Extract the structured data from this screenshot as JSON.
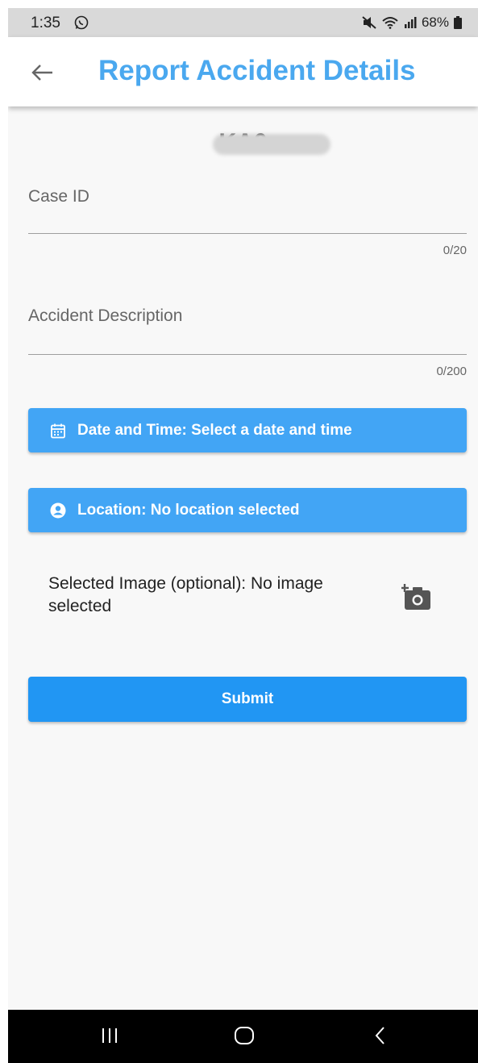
{
  "status_bar": {
    "time": "1:35",
    "battery": "68%",
    "icons": [
      "whatsapp-icon",
      "mute-icon",
      "wifi-icon",
      "signal-icon",
      "battery-icon"
    ]
  },
  "app_bar": {
    "title": "Report Accident Details",
    "back_icon": "arrow-left-icon"
  },
  "vehicle_number": "KA0",
  "form": {
    "case_id": {
      "label": "Case ID",
      "value": "",
      "counter": "0/20"
    },
    "description": {
      "label": "Accident Description",
      "value": "",
      "counter": "0/200"
    },
    "date_time_button": "Date and Time: Select a date and time",
    "location_button": "Location: No location selected",
    "image_text": "Selected Image (optional): No image selected",
    "submit_label": "Submit"
  },
  "colors": {
    "accent": "#4aa8ef",
    "button_light": "#42a5f5",
    "button_primary": "#2196f3"
  }
}
